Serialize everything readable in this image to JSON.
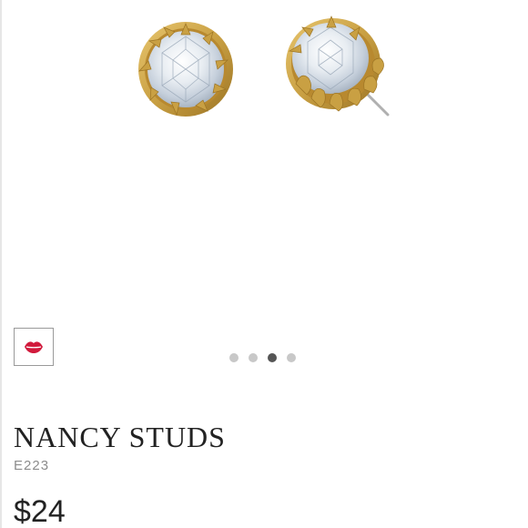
{
  "product": {
    "title": "NANCY STUDS",
    "sku": "E223",
    "price": "$24",
    "image_icon": "stud-earrings-image"
  },
  "favorite": {
    "icon": "lips-icon",
    "color": "#d11a3c"
  },
  "carousel": {
    "slide_count": 4,
    "active_index": 2
  },
  "colors": {
    "gold": "#c9a043",
    "gold_dark": "#a87e2a",
    "crystal": "#d7dfe8"
  }
}
